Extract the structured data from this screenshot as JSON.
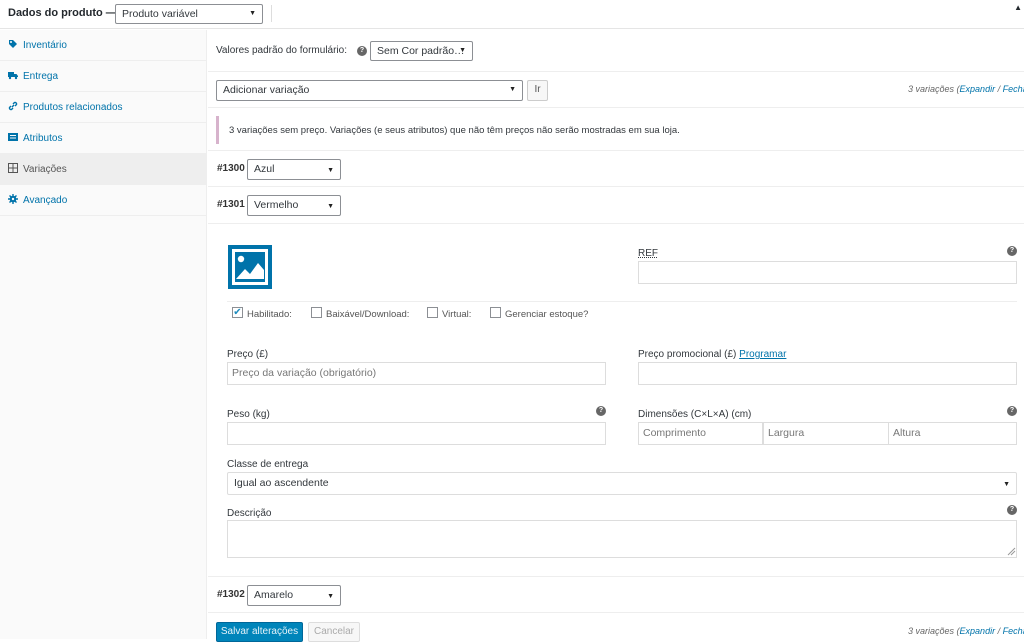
{
  "header": {
    "title": "Dados do produto —",
    "product_type": "Produto variável",
    "collapse_icon": "triangle-up-icon"
  },
  "sidebar": {
    "items": [
      {
        "label": "Inventário",
        "icon": "tag-icon"
      },
      {
        "label": "Entrega",
        "icon": "truck-icon"
      },
      {
        "label": "Produtos relacionados",
        "icon": "link-icon"
      },
      {
        "label": "Atributos",
        "icon": "list-icon"
      },
      {
        "label": "Variações",
        "icon": "grid-icon",
        "active": true
      },
      {
        "label": "Avançado",
        "icon": "gear-icon"
      }
    ]
  },
  "defaults": {
    "label": "Valores padrão do formulário:",
    "value": "Sem Cor padrão…"
  },
  "add_variation": {
    "select_value": "Adicionar variação",
    "go_label": "Ir",
    "count_text": "3 variações",
    "expand": "Expandir",
    "separator": "/",
    "close": "Fechar",
    "open_paren": "(",
    "close_paren": ")"
  },
  "notice": "3 variações sem preço. Variações (e seus atributos) que não têm preços não serão mostradas em sua loja.",
  "variations": [
    {
      "id": "#1300",
      "value": "Azul"
    },
    {
      "id": "#1301",
      "value": "Vermelho"
    },
    {
      "id": "#1302",
      "value": "Amarelo"
    }
  ],
  "variation_form": {
    "sku_label": "REF",
    "checkboxes": [
      {
        "label": "Habilitado:",
        "checked": true
      },
      {
        "label": "Baixável/Download:",
        "checked": false
      },
      {
        "label": "Virtual:",
        "checked": false
      },
      {
        "label": "Gerenciar estoque?",
        "checked": false
      }
    ],
    "price_label": "Preço (£)",
    "price_placeholder": "Preço da variação (obrigatório)",
    "sale_price_label": "Preço promocional (£)",
    "schedule_link": "Programar",
    "weight_label": "Peso (kg)",
    "dimensions_label": "Dimensões (C×L×A) (cm)",
    "length_placeholder": "Comprimento",
    "width_placeholder": "Largura",
    "height_placeholder": "Altura",
    "shipping_class_label": "Classe de entrega",
    "shipping_class_value": "Igual ao ascendente",
    "description_label": "Descrição"
  },
  "footer": {
    "save_label": "Salvar alterações",
    "cancel_label": "Cancelar",
    "count_text": "3 variações",
    "expand": "Expandir",
    "separator": "/",
    "close": "Fechar",
    "open_paren": "(",
    "close_paren": ")"
  },
  "colors": {
    "accent": "#0073aa",
    "primary_button": "#0085ba",
    "notice_border": "#d7b3cc"
  }
}
